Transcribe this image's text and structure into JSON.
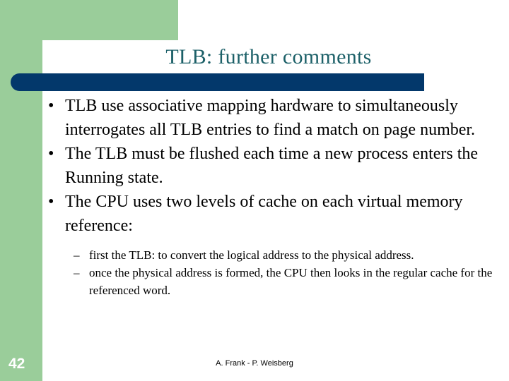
{
  "slide": {
    "title": "TLB: further comments",
    "page_number": "42",
    "footer_credit": "A. Frank - P. Weisberg",
    "colors": {
      "green": "#9ACD9A",
      "navy": "#03386B",
      "title_teal": "#1C6068",
      "background": "#FFFFFF",
      "body_text": "#000000"
    },
    "bullets": [
      {
        "marker": "•",
        "text": "TLB use associative mapping hardware to simultaneously interrogates all TLB entries to find a match on page number."
      },
      {
        "marker": "•",
        "text": "The TLB must be flushed each time a new process enters the Running state."
      },
      {
        "marker": "•",
        "text": "The CPU uses two levels of cache on each virtual memory reference:"
      }
    ],
    "sub_bullets": [
      {
        "marker": "–",
        "text": "first the TLB: to convert the logical address to the physical address."
      },
      {
        "marker": "–",
        "text": "once the physical address is formed, the CPU then looks in the regular cache for the referenced word."
      }
    ]
  }
}
